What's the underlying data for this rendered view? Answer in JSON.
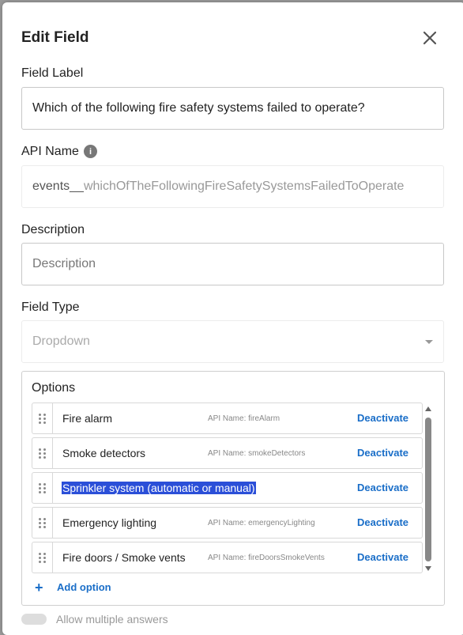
{
  "dialog": {
    "title": "Edit Field",
    "field_label": {
      "label": "Field Label",
      "value": "Which of the following fire safety systems failed to operate?"
    },
    "api_name": {
      "label": "API Name",
      "prefix": "events__",
      "value": "whichOfTheFollowingFireSafetySystemsFailedToOperate"
    },
    "description": {
      "label": "Description",
      "placeholder": "Description"
    },
    "field_type": {
      "label": "Field Type",
      "value": "Dropdown"
    },
    "options": {
      "label": "Options",
      "items": [
        {
          "label": "Fire alarm",
          "api": "API Name: fireAlarm",
          "action": "Deactivate"
        },
        {
          "label": "Smoke detectors",
          "api": "API Name: smokeDetectors",
          "action": "Deactivate"
        },
        {
          "label": "Sprinkler system (automatic or manual)",
          "api": "",
          "action": "Deactivate"
        },
        {
          "label": "Emergency lighting",
          "api": "API Name: emergencyLighting",
          "action": "Deactivate"
        },
        {
          "label": "Fire doors / Smoke vents",
          "api": "API Name: fireDoorsSmokeVents",
          "action": "Deactivate"
        }
      ],
      "add_label": "Add option"
    },
    "allow_multiple": {
      "label": "Allow multiple answers"
    }
  },
  "colors": {
    "accent": "#1a6ec8",
    "selection": "#2b4fd8"
  }
}
